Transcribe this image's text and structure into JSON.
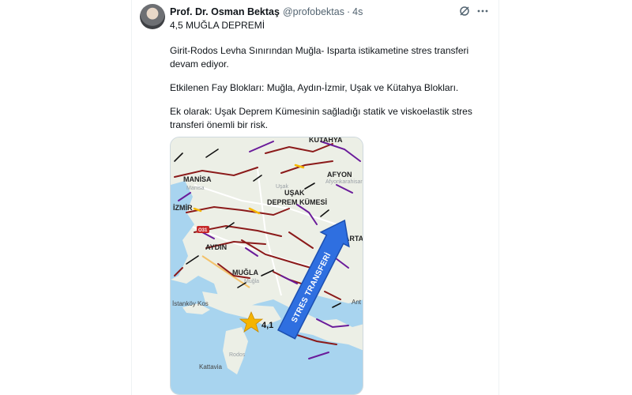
{
  "post": {
    "author_name": "Prof. Dr. Osman Bektaş",
    "handle": "@profobektas",
    "separator": "·",
    "time": "4s",
    "paragraphs": [
      "4,5 MUĞLA DEPREMİ",
      "Girit-Rodos Levha Sınırından Muğla- Isparta istikametine stres transferi devam ediyor.",
      "Etkilenen Fay Blokları: Muğla, Aydın-İzmir, Uşak ve Kütahya Blokları.",
      "Ek olarak: Uşak Deprem Kümesinin sağladığı statik ve viskoelastik stres transferi önemli bir risk."
    ]
  },
  "map": {
    "labels": {
      "kutahya": "KÜTAHYA",
      "manisa": "MANİSA",
      "manisa_sub": "Manisa",
      "izmir": "İZMİR",
      "afyon": "AFYON",
      "afyon_sub": "Afyonkarahisar",
      "usak_sub": "Uşak",
      "usak_cluster_line1": "UŞAK",
      "usak_cluster_line2": "DEPREM KÜMESİ",
      "aydin": "AYDIN",
      "isparta": "İSPARTA",
      "mugla": "MUĞLA",
      "mugla_sub": "Muğla",
      "kos": "İstanköy Kos",
      "ant": "Ant",
      "rodos": "Rodos",
      "kattavia": "Kattavia",
      "magnitude": "4,1",
      "arrow_text": "STRES TRANSFERİ",
      "road_sign": "O31"
    },
    "colors": {
      "land": "#ecefe6",
      "sea": "#a8d4ef",
      "fault_dark_red": "#8b1a1a",
      "fault_purple": "#6a1b9a",
      "fault_black": "#111111",
      "fault_yellow": "#f6b800",
      "arrow_fill": "#2f6fe0",
      "star": "#f5b400"
    }
  }
}
